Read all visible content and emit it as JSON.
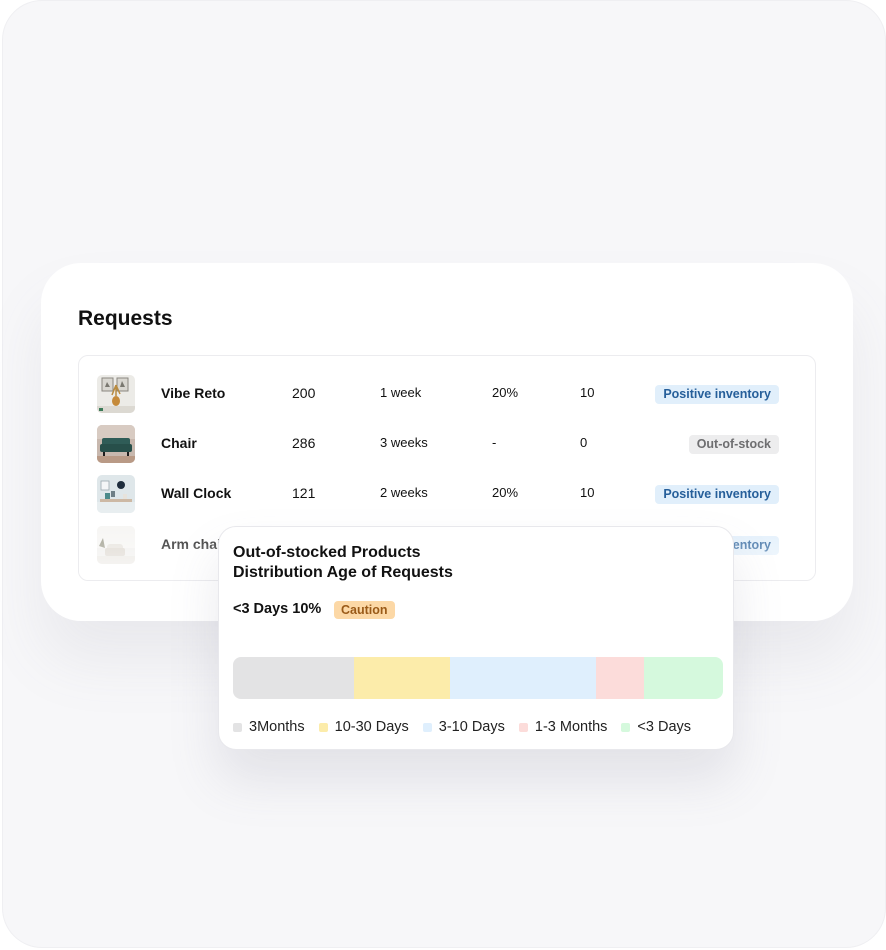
{
  "title": "Requests",
  "rows": [
    {
      "name": "Vibe Reto",
      "qty": "200",
      "time": "1 week",
      "pct": "20%",
      "count": "10",
      "status": "Positive inventory",
      "status_type": "positive",
      "thumb_icon": "wall-art-vase-photo"
    },
    {
      "name": "Chair",
      "qty": "286",
      "time": "3 weeks",
      "pct": "-",
      "count": "0",
      "status": "Out-of-stock",
      "status_type": "neutral",
      "thumb_icon": "green-sofa-photo"
    },
    {
      "name": "Wall Clock",
      "qty": "121",
      "time": "2 weeks",
      "pct": "20%",
      "count": "10",
      "status": "Positive inventory",
      "status_type": "positive",
      "thumb_icon": "wall-clock-room-photo"
    },
    {
      "name": "Arm chai",
      "qty": "",
      "time": "",
      "pct": "",
      "count": "",
      "status": "ventory",
      "status_type": "positive",
      "thumb_icon": "arm-chair-photo"
    }
  ],
  "popup": {
    "title_line1": "Out-of-stocked Products",
    "title_line2": "Distribution Age of Requests",
    "stat": "<3 Days 10%",
    "badge": "Caution",
    "legend": [
      {
        "label": "3Months",
        "color": "#e3e3e4",
        "share": 0.247
      },
      {
        "label": "10-30 Days",
        "color": "#fcecaa",
        "share": 0.196
      },
      {
        "label": "3-10 Days",
        "color": "#dfeffd",
        "share": 0.298
      },
      {
        "label": "1-3 Months",
        "color": "#fcdcda",
        "share": 0.098
      },
      {
        "label": "<3 Days",
        "color": "#d5f9dd",
        "share": 0.161
      }
    ]
  },
  "colors": {
    "positive_bg": "#e1effb",
    "positive_text": "#265f9a",
    "neutral_bg": "#ededee",
    "neutral_text": "#6e6e70",
    "caution_bg": "#fcd8a6",
    "caution_text": "#9a5a18"
  }
}
